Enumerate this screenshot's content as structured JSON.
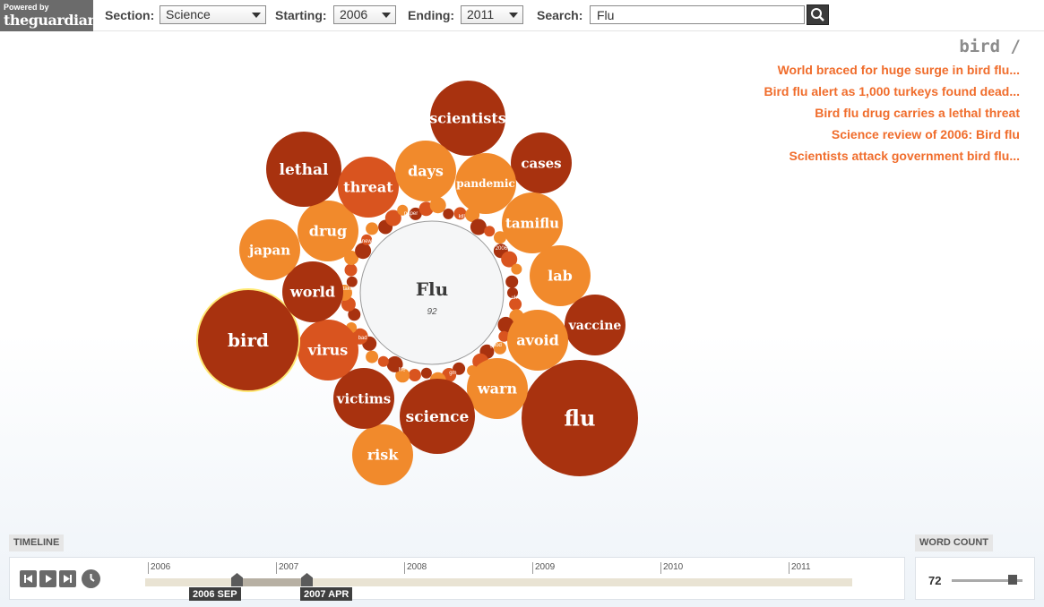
{
  "logo": {
    "small": "Powered by",
    "big": "theguardian"
  },
  "controls": {
    "section_label": "Section:",
    "section_value": "Science",
    "starting_label": "Starting:",
    "starting_value": "2006",
    "ending_label": "Ending:",
    "ending_value": "2011",
    "search_label": "Search:",
    "search_value": "Flu"
  },
  "selected_word": "bird /",
  "articles": [
    "World braced for huge surge in bird flu...",
    "Bird flu alert as 1,000 turkeys found dead...",
    "Bird flu drug carries a lethal threat",
    "Science review of 2006: Bird flu",
    "Scientists attack government bird flu..."
  ],
  "center": {
    "word": "Flu",
    "count": "92"
  },
  "colors": {
    "dark": "#a8320f",
    "mid": "#d9541f",
    "light": "#f18a2c",
    "link": "#f06d2c",
    "highlight": "#ffe873"
  },
  "bubbles": [
    {
      "word": "scientists",
      "tone": "dark"
    },
    {
      "word": "cases",
      "tone": "dark"
    },
    {
      "word": "tamiflu",
      "tone": "light"
    },
    {
      "word": "lab",
      "tone": "light"
    },
    {
      "word": "vaccine",
      "tone": "dark"
    },
    {
      "word": "avoid",
      "tone": "light"
    },
    {
      "word": "flu",
      "tone": "dark"
    },
    {
      "word": "warn",
      "tone": "light"
    },
    {
      "word": "science",
      "tone": "dark"
    },
    {
      "word": "risk",
      "tone": "light"
    },
    {
      "word": "victims",
      "tone": "dark"
    },
    {
      "word": "virus",
      "tone": "mid"
    },
    {
      "word": "bird",
      "tone": "dark",
      "selected": true
    },
    {
      "word": "world",
      "tone": "dark"
    },
    {
      "word": "japan",
      "tone": "light"
    },
    {
      "word": "drug",
      "tone": "light"
    },
    {
      "word": "lethal",
      "tone": "dark"
    },
    {
      "word": "threat",
      "tone": "mid"
    },
    {
      "word": "days",
      "tone": "light"
    },
    {
      "word": "pandemic",
      "tone": "light"
    }
  ],
  "small_words": [
    "kill",
    "2006",
    "uk",
    "good",
    "gm",
    "life",
    "bad",
    "taken",
    "news",
    "paper"
  ],
  "timeline": {
    "label": "TIMELINE",
    "years": [
      "2006",
      "2007",
      "2008",
      "2009",
      "2010",
      "2011"
    ],
    "start_label": "2006 SEP",
    "end_label": "2007 APR"
  },
  "word_count": {
    "label": "WORD COUNT",
    "value": "72"
  }
}
